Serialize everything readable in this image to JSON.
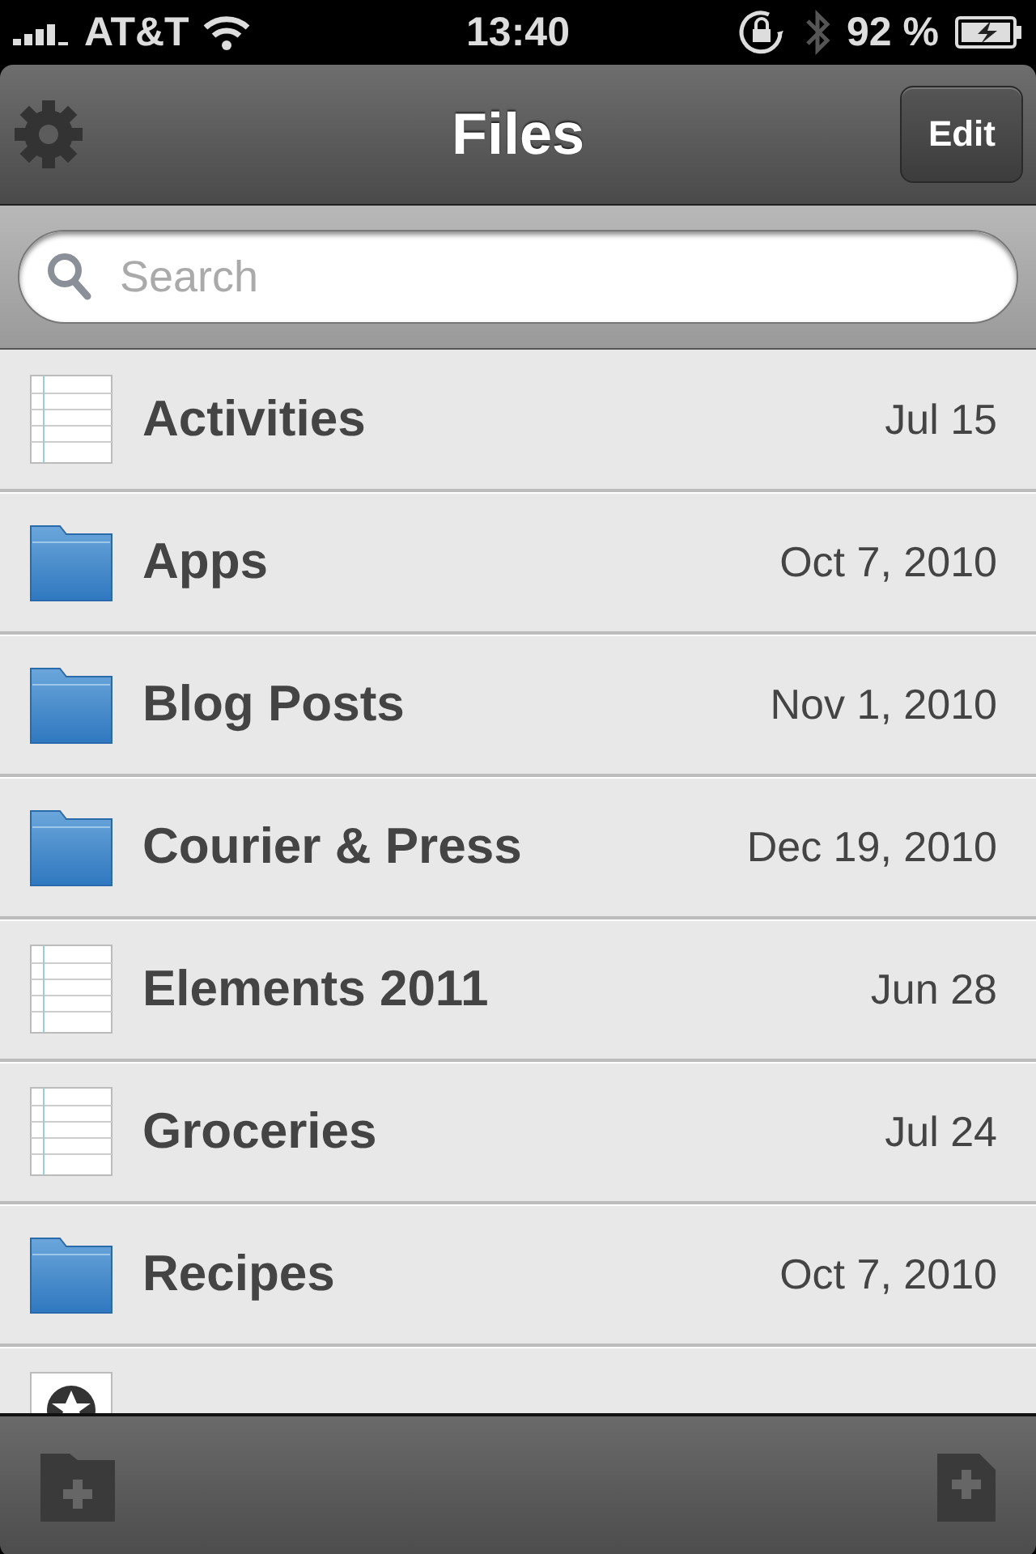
{
  "status_bar": {
    "carrier": "AT&T",
    "time": "13:40",
    "battery": "92 %"
  },
  "nav_bar": {
    "title": "Files",
    "edit_button": "Edit"
  },
  "search": {
    "placeholder": "Search"
  },
  "files": [
    {
      "kind": "note",
      "name": "Activities",
      "date": "Jul 15"
    },
    {
      "kind": "folder",
      "name": "Apps",
      "date": "Oct 7, 2010"
    },
    {
      "kind": "folder",
      "name": "Blog Posts",
      "date": "Nov 1, 2010"
    },
    {
      "kind": "folder",
      "name": "Courier & Press",
      "date": "Dec 19, 2010"
    },
    {
      "kind": "note",
      "name": "Elements 2011",
      "date": "Jun 28"
    },
    {
      "kind": "note",
      "name": "Groceries",
      "date": "Jul 24"
    },
    {
      "kind": "folder",
      "name": "Recipes",
      "date": "Oct 7, 2010"
    },
    {
      "kind": "starred"
    }
  ]
}
